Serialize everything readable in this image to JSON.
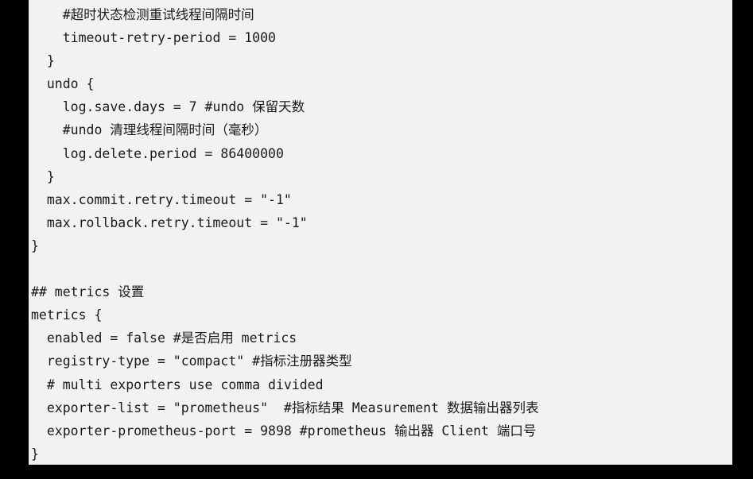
{
  "code": {
    "lines": [
      "    #超时状态检测重试线程间隔时间",
      "    timeout-retry-period = 1000",
      "  }",
      "  undo {",
      "    log.save.days = 7 #undo 保留天数",
      "    #undo 清理线程间隔时间（毫秒）",
      "    log.delete.period = 86400000",
      "  }",
      "  max.commit.retry.timeout = \"-1\"",
      "  max.rollback.retry.timeout = \"-1\"",
      "}",
      "",
      "## metrics 设置",
      "metrics {",
      "  enabled = false #是否启用 metrics",
      "  registry-type = \"compact\" #指标注册器类型",
      "  # multi exporters use comma divided",
      "  exporter-list = \"prometheus\"  #指标结果 Measurement 数据输出器列表",
      "  exporter-prometheus-port = 9898 #prometheus 输出器 Client 端口号",
      "}"
    ]
  }
}
